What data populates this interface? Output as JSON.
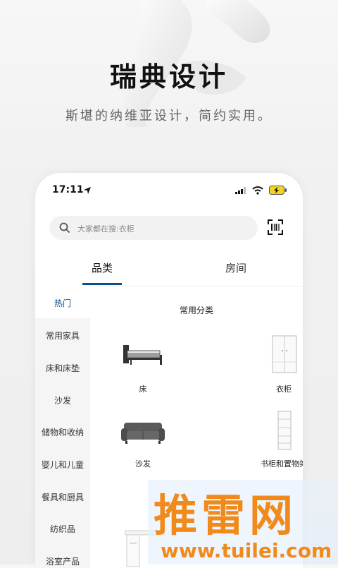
{
  "hero": {
    "title": "瑞典设计",
    "subtitle": "斯堪的纳维亚设计，简约实用。"
  },
  "status_bar": {
    "time": "17:11"
  },
  "search": {
    "placeholder": "大家都在搜:衣柜"
  },
  "tabs": {
    "category": "品类",
    "rooms": "房间"
  },
  "sidebar": {
    "items": [
      {
        "label": "热门",
        "active": true
      },
      {
        "label": "常用家具"
      },
      {
        "label": "床和床垫"
      },
      {
        "label": "沙发"
      },
      {
        "label": "储物和收纳"
      },
      {
        "label": "婴儿和儿童"
      },
      {
        "label": "餐具和厨具"
      },
      {
        "label": "纺织品"
      },
      {
        "label": "浴室产品"
      }
    ]
  },
  "main": {
    "section_title": "常用分类",
    "products": [
      {
        "label": "床",
        "icon": "bed-image"
      },
      {
        "label": "衣柜",
        "icon": "wardrobe-image"
      },
      {
        "label": "沙发",
        "icon": "sofa-image"
      },
      {
        "label": "书柜和置物架",
        "icon": "bookshelf-image"
      }
    ]
  },
  "watermark": {
    "text": "推雷网",
    "url": "www.tuilei.com"
  },
  "colors": {
    "accent": "#0b4f8a",
    "watermark": "#f08a1c"
  }
}
